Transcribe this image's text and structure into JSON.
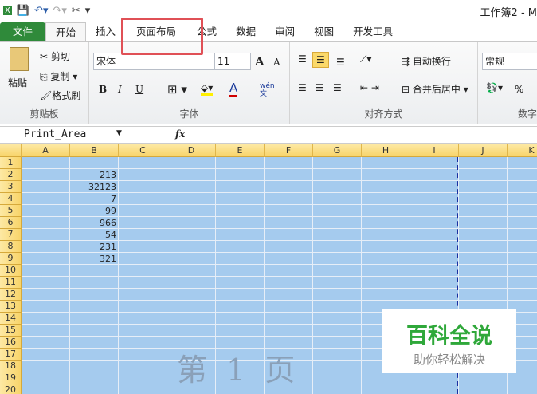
{
  "window": {
    "title": "工作簿2 - M"
  },
  "quick_access": [
    "excel-icon",
    "save-icon",
    "undo-icon",
    "redo-icon",
    "tools-icon",
    "customize-icon"
  ],
  "tabs": [
    {
      "label": "文件"
    },
    {
      "label": "开始"
    },
    {
      "label": "插入"
    },
    {
      "label": "页面布局"
    },
    {
      "label": "公式"
    },
    {
      "label": "数据"
    },
    {
      "label": "审阅"
    },
    {
      "label": "视图"
    },
    {
      "label": "开发工具"
    }
  ],
  "ribbon": {
    "clipboard": {
      "label": "剪贴板",
      "paste": "粘贴",
      "cut": "剪切",
      "copy": "复制",
      "format_painter": "格式刷"
    },
    "font": {
      "label": "字体",
      "name": "宋体",
      "size": "11",
      "bold": "B",
      "italic": "I",
      "underline": "U",
      "grow": "A",
      "shrink": "A",
      "font_color": "A",
      "phonetic": "wén 文"
    },
    "alignment": {
      "label": "对齐方式",
      "wrap": "自动换行",
      "merge": "合并后居中"
    },
    "number": {
      "label": "数字",
      "format": "常规",
      "percent": "%"
    }
  },
  "formula_bar": {
    "name_box": "Print_Area",
    "fx": "fx",
    "value": ""
  },
  "columns": [
    "A",
    "B",
    "C",
    "D",
    "E",
    "F",
    "G",
    "H",
    "I",
    "J",
    "K"
  ],
  "rows": [
    "1",
    "2",
    "3",
    "4",
    "5",
    "6",
    "7",
    "8",
    "9",
    "10",
    "11",
    "12",
    "13",
    "14",
    "15",
    "16",
    "17",
    "18",
    "19",
    "20"
  ],
  "cells_B": [
    {
      "row": 2,
      "value": "213"
    },
    {
      "row": 3,
      "value": "32123"
    },
    {
      "row": 4,
      "value": "7"
    },
    {
      "row": 5,
      "value": "99"
    },
    {
      "row": 6,
      "value": "966"
    },
    {
      "row": 7,
      "value": "54"
    },
    {
      "row": 8,
      "value": "231"
    },
    {
      "row": 9,
      "value": "321"
    }
  ],
  "page_watermark": "第 1 页",
  "logo": {
    "title": "百科全说",
    "subtitle": "助你轻松解决"
  },
  "colors": {
    "selection": "#a5cbee",
    "file_tab": "#2f8a3a",
    "highlight": "#e05056",
    "page_break": "#1a2fa0"
  }
}
